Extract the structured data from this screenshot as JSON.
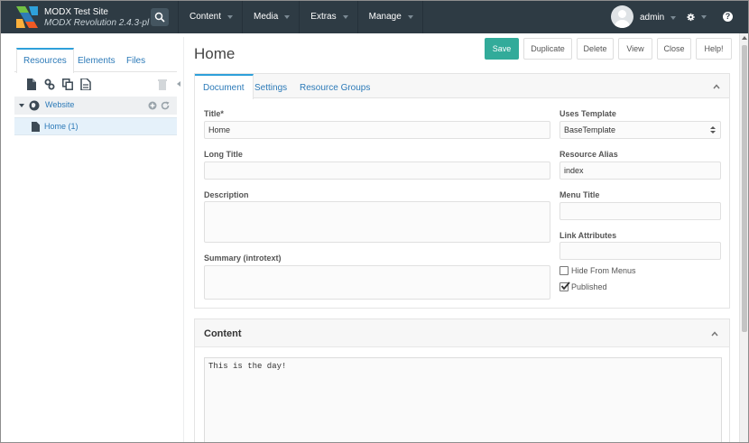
{
  "topbar": {
    "site_name": "MODX Test Site",
    "site_version": "MODX Revolution 2.4.3-pl",
    "nav": [
      {
        "label": "Content"
      },
      {
        "label": "Media"
      },
      {
        "label": "Extras"
      },
      {
        "label": "Manage"
      }
    ],
    "user": "admin",
    "help_label": "?"
  },
  "left": {
    "tabs": [
      "Resources",
      "Elements",
      "Files"
    ],
    "active_tab": "Resources",
    "tree": {
      "context": "Website",
      "items": [
        {
          "label": "Home (1)"
        }
      ]
    }
  },
  "main": {
    "title": "Home",
    "actions": [
      "Save",
      "Duplicate",
      "Delete",
      "View",
      "Close",
      "Help!"
    ],
    "tabs": [
      "Document",
      "Settings",
      "Resource Groups"
    ],
    "active_tab": "Document",
    "fields": {
      "title_label": "Title*",
      "title_value": "Home",
      "longtitle_label": "Long Title",
      "longtitle_value": "",
      "description_label": "Description",
      "description_value": "",
      "summary_label": "Summary (introtext)",
      "summary_value": "",
      "template_label": "Uses Template",
      "template_value": "BaseTemplate",
      "alias_label": "Resource Alias",
      "alias_value": "index",
      "menutitle_label": "Menu Title",
      "menutitle_value": "",
      "linkattr_label": "Link Attributes",
      "linkattr_value": "",
      "hide_menus_label": "Hide From Menus",
      "hide_menus_checked": false,
      "published_label": "Published",
      "published_checked": true
    },
    "content": {
      "heading": "Content",
      "text": "This is the day!"
    }
  },
  "colors": {
    "topbar": "#2e3b44",
    "accent": "#2ea0da",
    "save": "#32ab9a"
  }
}
